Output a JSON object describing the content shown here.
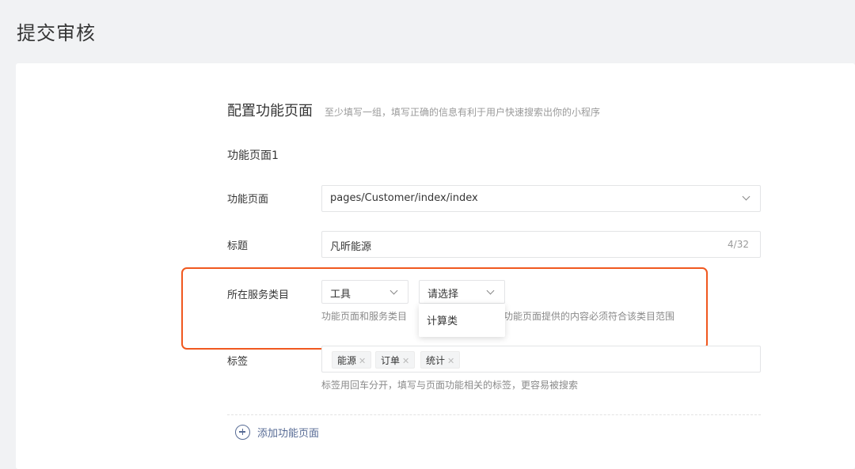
{
  "page": {
    "title": "提交审核"
  },
  "section": {
    "title": "配置功能页面",
    "description": "至少填写一组，填写正确的信息有利于用户快速搜索出你的小程序"
  },
  "group": {
    "title": "功能页面1",
    "page_label": "功能页面",
    "page_value": "pages/Customer/index/index",
    "title_label": "标题",
    "title_value": "凡昕能源",
    "title_counter": "4/32",
    "category_label": "所在服务类目",
    "category_first": "工具",
    "category_second_placeholder": "请选择",
    "category_tip_left": "功能页面和服务类目",
    "category_tip_right": "功能页面提供的内容必须符合该类目范围",
    "dropdown_options": [
      "计算类"
    ],
    "tags_label": "标签",
    "tags": [
      "能源",
      "订单",
      "统计"
    ],
    "tags_tip": "标签用回车分开，填写与页面功能相关的标签，更容易被搜索"
  },
  "actions": {
    "add_page": "添加功能页面"
  },
  "colors": {
    "highlight": "#f0581f",
    "link": "#576b95",
    "background": "#f1f2f4"
  }
}
